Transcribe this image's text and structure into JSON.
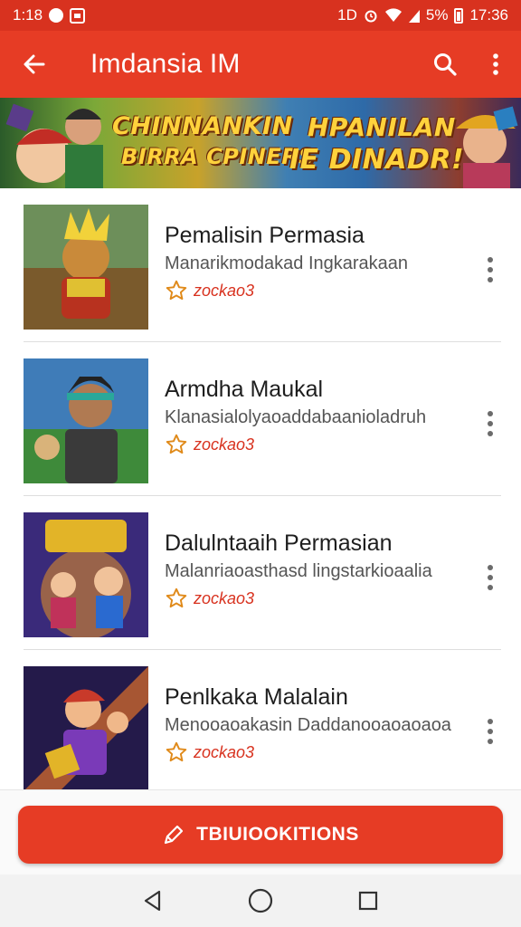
{
  "status_bar": {
    "left_time": "1:18",
    "right_time": "17:36",
    "battery_percent": "5%",
    "signal_text": "1D"
  },
  "app_bar": {
    "title": "Imdansia IM"
  },
  "banner": {
    "line1": "CHINNANKIN",
    "line2": "BIRRA CPINERS",
    "line3": "HPANILAN",
    "line4": "IE DINADR!"
  },
  "items": [
    {
      "title": "Pemalisin Permasia",
      "description": "Manarikmodakad Ingkarakaan",
      "rating": "zockao3"
    },
    {
      "title": "Armdha Maukal",
      "description": "Klanasialolyaoaddabaanioladruh",
      "rating": "zockao3"
    },
    {
      "title": "Dalulntaaih Permasian",
      "description": "Malanriaoasthasd lingstarkioaalia",
      "rating": "zockao3"
    },
    {
      "title": "Penlkaka Malalain",
      "description": "Menooaoakasin Daddanooaoaoaoa",
      "rating": "zockao3"
    }
  ],
  "footer": {
    "cta_label": "TBIUIOOKITIONS"
  },
  "colors": {
    "primary": "#e63c25",
    "status_bar": "#d8321f",
    "rating": "#d8321f"
  },
  "icons": {
    "back": "arrow-left-icon",
    "search": "search-icon",
    "overflow": "more-vertical-icon",
    "star": "star-outline-icon",
    "cta": "pencil-icon",
    "nav_back": "triangle-back-icon",
    "nav_home": "circle-home-icon",
    "nav_recent": "square-recent-icon"
  }
}
